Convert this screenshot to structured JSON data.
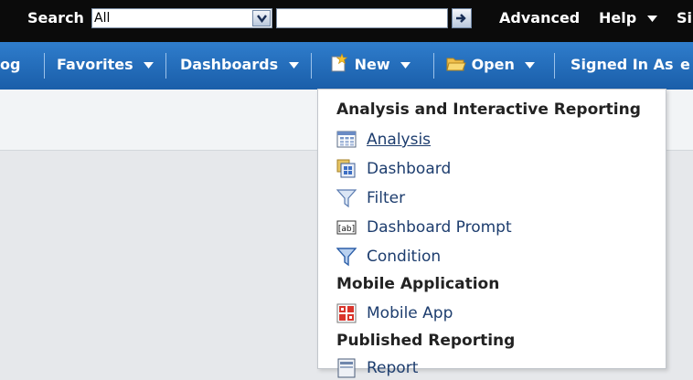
{
  "topbar": {
    "search_label": "Search",
    "scope_value": "All",
    "search_value": "",
    "advanced_label": "Advanced",
    "help_label": "Help",
    "signout_partial": "Si"
  },
  "navbar": {
    "catalog_partial": "og",
    "favorites_label": "Favorites",
    "dashboards_label": "Dashboards",
    "new_label": "New",
    "open_label": "Open",
    "signed_in_label": "Signed In As",
    "user_partial": "e"
  },
  "new_menu": {
    "sections": [
      {
        "header": "Analysis and Interactive Reporting",
        "items": [
          {
            "label": "Analysis",
            "icon": "analysis-icon"
          },
          {
            "label": "Dashboard",
            "icon": "dashboard-icon"
          },
          {
            "label": "Filter",
            "icon": "filter-icon"
          },
          {
            "label": "Dashboard Prompt",
            "icon": "dashboard-prompt-icon"
          },
          {
            "label": "Condition",
            "icon": "condition-icon"
          }
        ]
      },
      {
        "header": "Mobile Application",
        "items": [
          {
            "label": "Mobile App",
            "icon": "mobile-app-icon"
          }
        ]
      },
      {
        "header": "Published Reporting",
        "items": [
          {
            "label": "Report",
            "icon": "report-icon"
          }
        ]
      }
    ]
  },
  "colors": {
    "topbar_bg": "#0b0b0b",
    "navbar_bg": "#2670c1",
    "menu_text": "#1d3d6e"
  }
}
